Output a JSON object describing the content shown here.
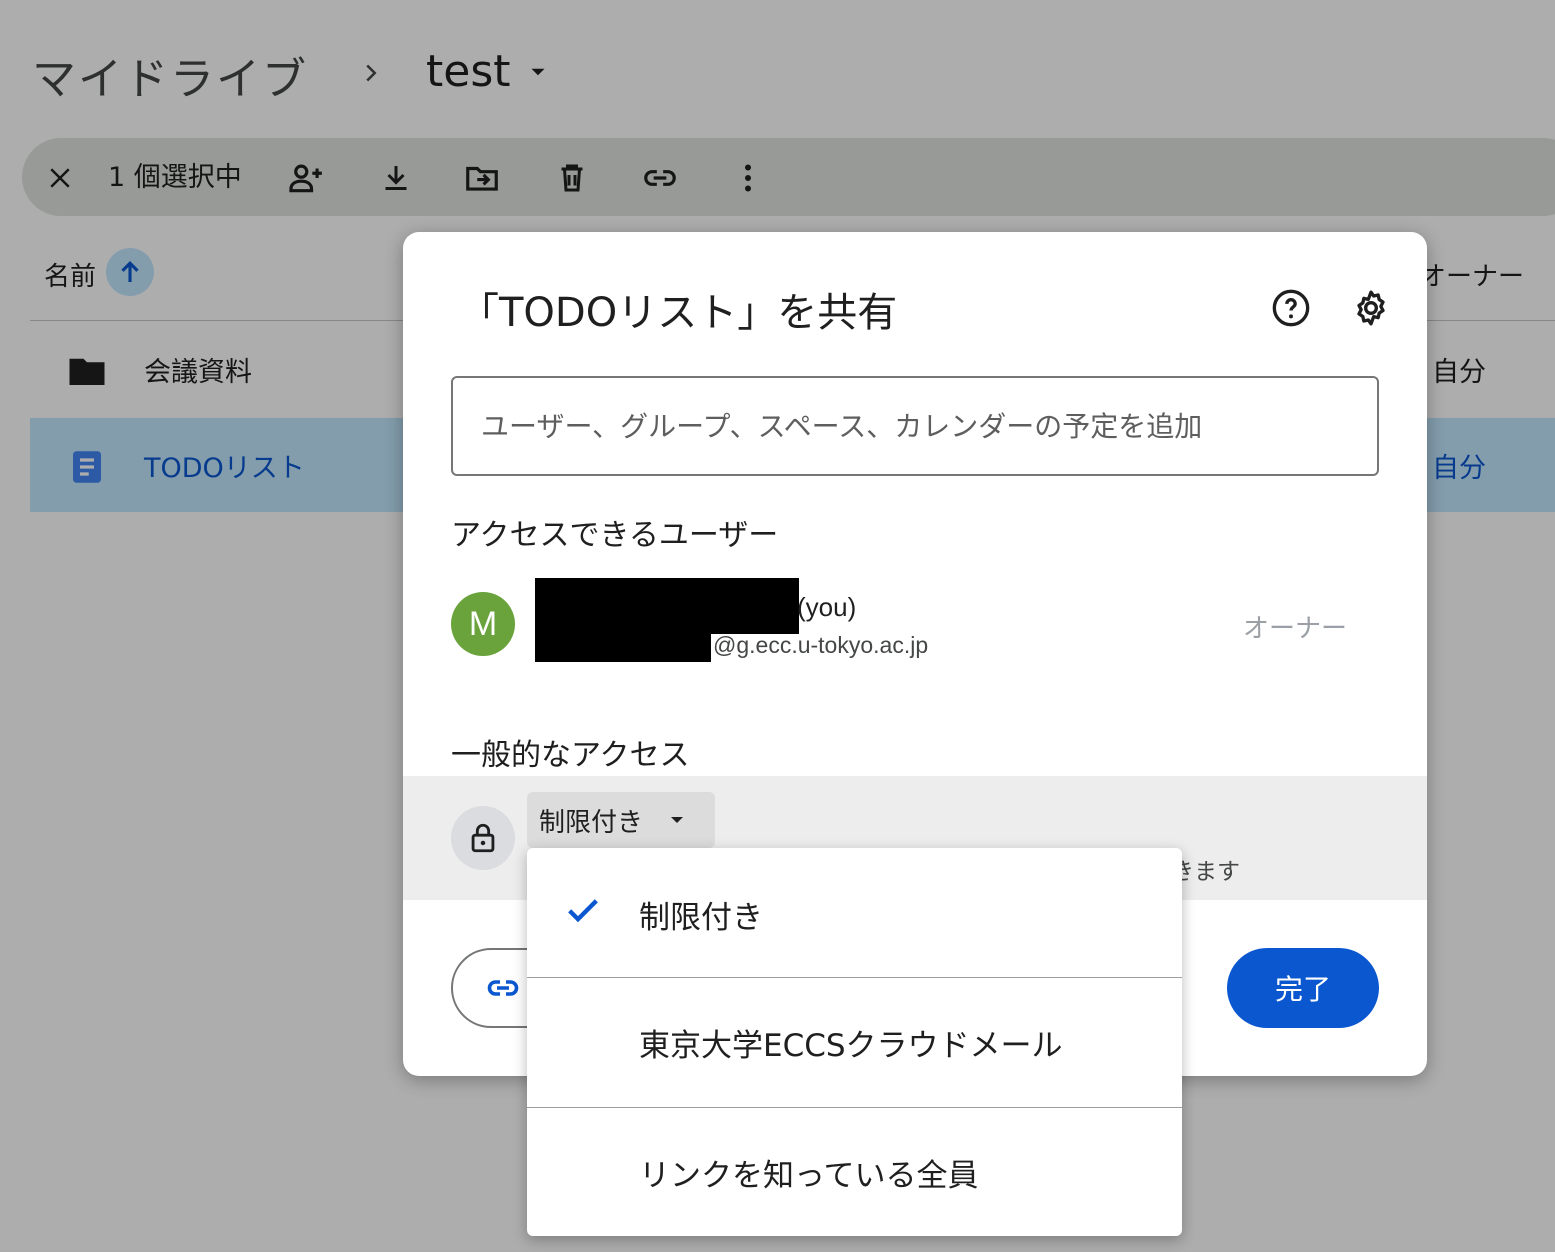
{
  "breadcrumb": {
    "root": "マイドライブ",
    "current": "test"
  },
  "toolbar": {
    "selected_count": "1 個選択中"
  },
  "file_list": {
    "header": {
      "name": "名前",
      "owner": "オーナー"
    },
    "rows": [
      {
        "name": "会議資料",
        "owner": "自分",
        "type": "folder-icon"
      },
      {
        "name": "TODOリスト",
        "owner": "自分",
        "type": "doc-icon",
        "selected": true
      }
    ]
  },
  "share_dialog": {
    "title": "「TODOリスト」を共有",
    "add_placeholder": "ユーザー、グループ、スペース、カレンダーの予定を追加",
    "people_section_title": "アクセスできるユーザー",
    "user": {
      "avatar_initial": "M",
      "name_suffix": "(you)",
      "email_suffix": "@g.ecc.u-tokyo.ac.jp",
      "role": "オーナー",
      "avatar_color": "#6aa33c"
    },
    "general_access_title": "一般的なアクセス",
    "access_value": "制限付き",
    "access_description_partial": "きます",
    "done_label": "完了",
    "accent_color": "#0b57d0"
  },
  "access_menu": {
    "items": [
      {
        "label": "制限付き",
        "checked": true
      },
      {
        "label": "東京大学ECCSクラウドメール",
        "checked": false
      },
      {
        "label": "リンクを知っている全員",
        "checked": false
      }
    ]
  }
}
